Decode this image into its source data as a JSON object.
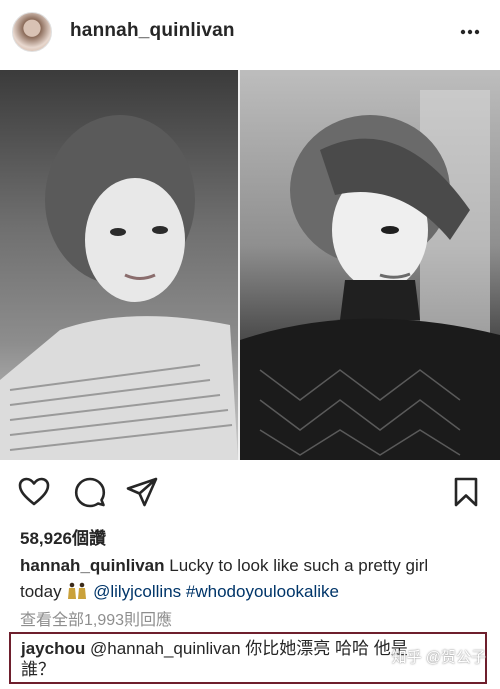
{
  "post": {
    "username": "hannah_quinlivan",
    "likes_text": "58,926個讚",
    "caption": {
      "username": "hannah_quinlivan",
      "text_1": "Lucky to look like such a pretty girl",
      "text_2": "today",
      "mention": "@lilyjcollins",
      "hashtag": "#whodoyoulookalike"
    },
    "view_all_comments": "查看全部1,993則回應"
  },
  "highlight_comment": {
    "username": "jaychou",
    "mention": "@hannah_quinlivan",
    "text": "你比她漂亮 哈哈 他是",
    "text_2": "誰？"
  },
  "watermark": "知乎 @贺公子",
  "icons": [
    "more-icon",
    "heart-icon",
    "comment-icon",
    "share-icon",
    "bookmark-icon"
  ]
}
